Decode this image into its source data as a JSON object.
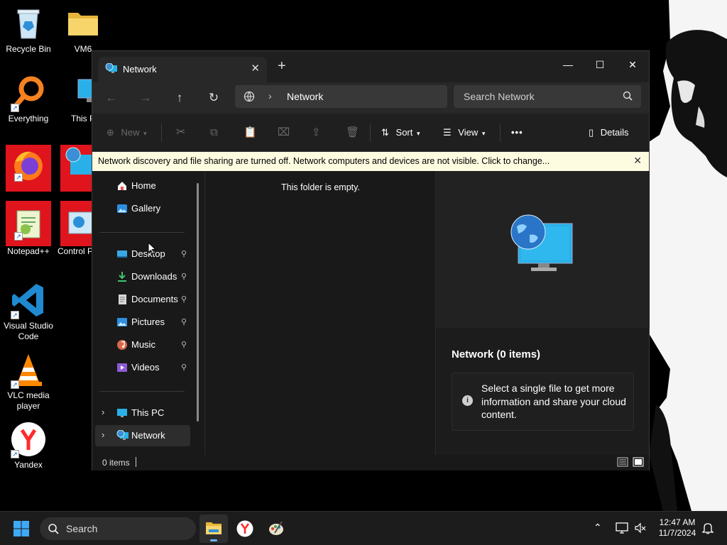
{
  "desktop": {
    "icons": [
      {
        "label": "Recycle Bin"
      },
      {
        "label": "VM6"
      },
      {
        "label": "Everything"
      },
      {
        "label": "This P"
      },
      {
        "label": "Firefox"
      },
      {
        "label": "Netwo"
      },
      {
        "label": "Notepad++"
      },
      {
        "label": "Control P"
      },
      {
        "label": "Visual Studio Code"
      },
      {
        "label": "VLC media player"
      },
      {
        "label": "Yandex"
      }
    ]
  },
  "window": {
    "tab_title": "Network",
    "tab_close": "✕",
    "new_tab": "+",
    "minimize": "—",
    "maximize": "☐",
    "close": "✕",
    "address": {
      "separator": "›",
      "crumb": "Network"
    },
    "search_placeholder": "Search Network",
    "commands": {
      "new": "New",
      "sort": "Sort",
      "view": "View",
      "more": "•••",
      "details": "Details"
    },
    "infobar": {
      "message": "Network discovery and file sharing are turned off. Network computers and devices are not visible. Click to change...",
      "close": "✕"
    },
    "nav": {
      "home": "Home",
      "gallery": "Gallery",
      "desktop": "Desktop",
      "downloads": "Downloads",
      "documents": "Documents",
      "pictures": "Pictures",
      "music": "Music",
      "videos": "Videos",
      "this_pc": "This PC",
      "network": "Network",
      "chevron": "›",
      "pin": "📌"
    },
    "content": {
      "empty_message": "This folder is empty."
    },
    "details": {
      "title": "Network (0 items)",
      "info_icon": "i",
      "info_text": "Select a single file to get more information and share your cloud content."
    },
    "status": {
      "count": "0 items"
    }
  },
  "taskbar": {
    "search_placeholder": "Search",
    "time": "12:47 AM",
    "date": "11/7/2024"
  },
  "colors": {
    "accent": "#4cc2ff",
    "infobar": "#fdfbe0",
    "window_bg": "#191919"
  }
}
